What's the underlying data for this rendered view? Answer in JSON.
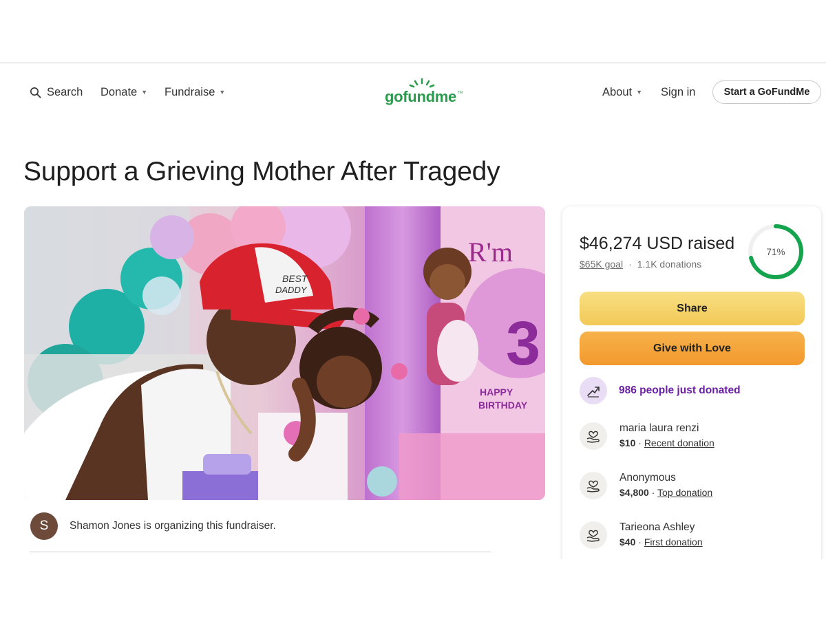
{
  "nav": {
    "search_label": "Search",
    "donate_label": "Donate",
    "fundraise_label": "Fundraise",
    "about_label": "About",
    "signin_label": "Sign in",
    "start_label": "Start a GoFundMe",
    "logo_text": "gofundme",
    "logo_mark": "TM"
  },
  "campaign": {
    "title": "Support a Grieving Mother After Tragedy",
    "organizer_initial": "S",
    "organizer_text": "Shamon Jones is organizing this fundraiser."
  },
  "donation_card": {
    "raised_text": "$46,274 USD raised",
    "goal_text": "$65K goal",
    "separator": "·",
    "donations_text": "1.1K donations",
    "progress_percent": 71,
    "progress_label": "71%",
    "share_label": "Share",
    "give_label": "Give with Love",
    "momentum_text": "986 people just donated",
    "donors": [
      {
        "name": "maria laura renzi",
        "amount": "$10",
        "sep": " · ",
        "tag": "Recent donation"
      },
      {
        "name": "Anonymous",
        "amount": "$4,800",
        "sep": " · ",
        "tag": "Top donation"
      },
      {
        "name": "Tarieona Ashley",
        "amount": "$40",
        "sep": " · ",
        "tag": "First donation"
      }
    ]
  },
  "colors": {
    "brand_green": "#2a9a4c",
    "share_yellow": "#f4cf66",
    "give_orange": "#f4a33a",
    "momentum_purple": "#6b1fa4",
    "avatar_brown": "#6e4a3a"
  },
  "icons": {
    "search": "search-icon",
    "caret": "caret-down-icon",
    "momentum": "trending-up-icon",
    "donor": "heart-hand-icon"
  }
}
